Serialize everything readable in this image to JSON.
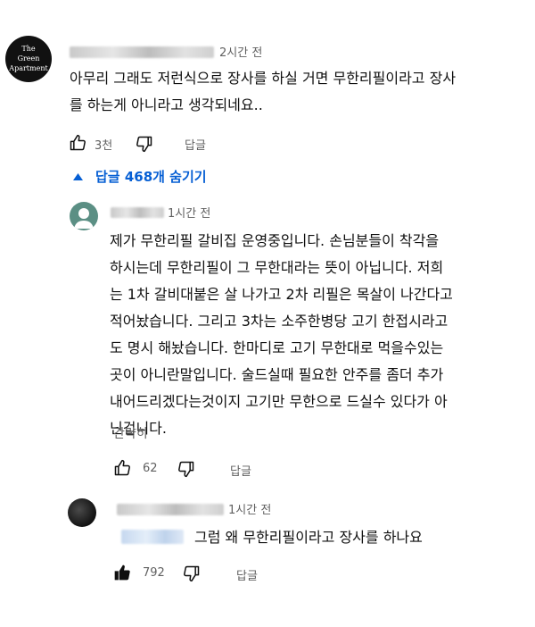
{
  "comment": {
    "avatar_text": "The\nGreen\nApartment",
    "time": "2시간 전",
    "text": "아무리 그래도 저런식으로 장사를 하실 거면 무한리필이라고 장사\n를 하는게 아니라고 생각되네요..",
    "likes": "3천",
    "reply_label": "답글"
  },
  "replies_toggle": {
    "label": "답글 468개 숨기기"
  },
  "reply1": {
    "time": "1시간 전",
    "text": "제가 무한리필 갈비집 운영중입니다. 손님분들이 착각을\n하시는데 무한리필이 그 무한대라는 뜻이 아닙니다. 저희\n는 1차 갈비대붙은 살 나가고 2차 리필은 목살이 나간다고\n적어놨습니다. 그리고 3차는 소주한병당 고기 한접시라고\n도 명시 해놨습니다. 한마디로 고기 무한대로 먹을수있는\n곳이 아니란말입니다. 술드실때 필요한 안주를 좀더 추가\n내어드리겠다는것이지 고기만 무한으로 드실수 있다가 아\n닌겁니다.",
    "read_less": "간략히",
    "likes": "62",
    "reply_label": "답글"
  },
  "reply2": {
    "time": "1시간 전",
    "text": "그럼 왜 무한리필이라고 장사를 하나요",
    "likes": "792",
    "reply_label": "답글"
  },
  "icons": {
    "like": "thumbs-up-icon",
    "like_filled": "thumbs-up-filled-icon",
    "dislike": "thumbs-down-icon",
    "collapse": "caret-up-icon"
  },
  "colors": {
    "link_blue": "#065fd4",
    "meta_gray": "#606060"
  }
}
